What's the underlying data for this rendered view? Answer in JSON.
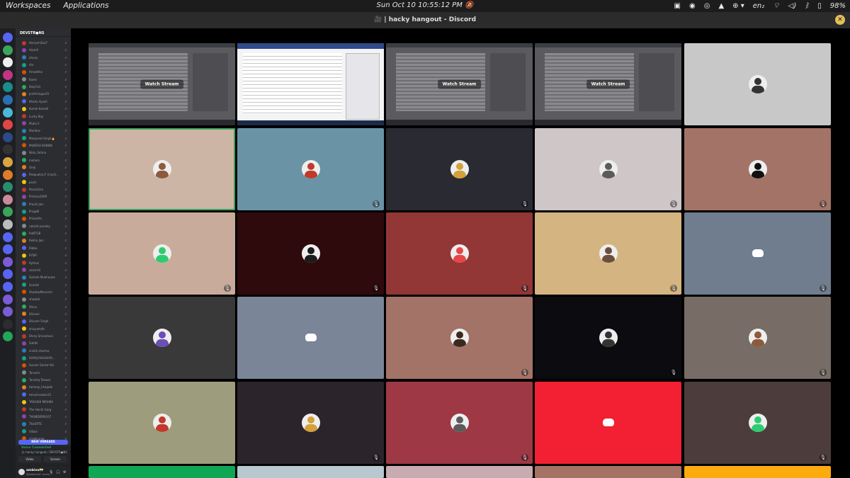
{
  "topbar": {
    "workspaces": "Workspaces",
    "applications": "Applications",
    "clock": "Sun Oct 10 10:55:12 PM",
    "lang": "en₂",
    "battery": "98%"
  },
  "window": {
    "title": "🎥 | hacky hangout - Discord",
    "close": "✕"
  },
  "server": {
    "name": "DEVSTR●NS"
  },
  "members": [
    "HarryshiGul7",
    "Haanit",
    "ahuny",
    "Ain",
    "Amadkha",
    "Kaeni",
    "KaiyCsit",
    "Joinfmingus01",
    "Khaha Ayush",
    "Kumal Kamall",
    "Lucky Boy",
    "Mulla.V",
    "Maribav",
    "Manpreet Singh🔥",
    "MUKESH KANWA",
    "Nidu_fatima",
    "mohars",
    "Omji",
    "Pasqualo/u7 (inacti...",
    "pisnil",
    "Pascashro",
    "Pristina2009",
    "Prachi Jain",
    "PragaB",
    "Prisanths",
    "rakshit.pandey",
    "RaNTGB",
    "Rekha Jain",
    "Ribba",
    "RiTaR",
    "Rythuk",
    "sanchrit",
    "Saimds Mukherjee",
    "Scarlet",
    "ShadowMonarch",
    "shaakal",
    "Shiva",
    "Shivani",
    "Shivam Singh",
    "shivyamdh",
    "Shrey Srivastava",
    "Siddhi",
    "srishti sharma",
    "SURAJ RAGHUVA...",
    "Suvam Sarkar Koi",
    "Tanushi",
    "Tanishq Tanwar",
    "tanmay_khajade",
    "tanushraskar21",
    "TARUSHI MISHRA",
    "The Harsh Garg",
    "THUNDERRGO7",
    "TitaURTS",
    "Villain",
    "viratkumar"
  ],
  "new_unreads": "NEW UNREADS",
  "voice": {
    "status": "Voice Connected",
    "channel": "🎥 hacky hangout / DEVSTR●NS",
    "video": "Video",
    "screen": "Screen"
  },
  "user": {
    "name": "ambivo🇮🇳",
    "status": "@ambivo#7 (invisi..."
  },
  "streams": {
    "label": "Watch Stream"
  },
  "colors": {
    "accent": "#5865f2",
    "speaking": "#3ba55d"
  }
}
